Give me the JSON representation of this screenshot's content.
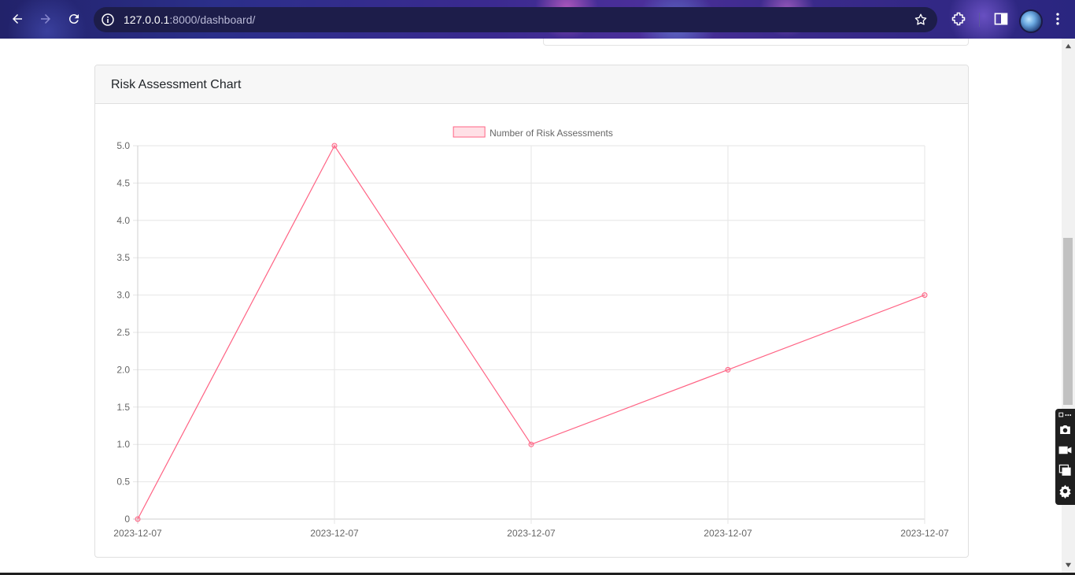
{
  "browser": {
    "url_host": "127.0.0.1",
    "url_path": ":8000/dashboard/",
    "icons": [
      "back-icon",
      "forward-icon",
      "reload-icon",
      "site-info-icon",
      "bookmark-star-icon",
      "extensions-icon",
      "side-panel-icon",
      "profile-avatar",
      "menu-kebab-icon"
    ]
  },
  "card": {
    "title": "Risk Assessment Chart"
  },
  "chart_data": {
    "type": "line",
    "x": [
      "2023-12-07",
      "2023-12-07",
      "2023-12-07",
      "2023-12-07",
      "2023-12-07"
    ],
    "series": [
      {
        "name": "Number of Risk Assessments",
        "values": [
          0,
          5,
          1,
          2,
          3
        ],
        "color": "#ff6384"
      }
    ],
    "ylim": [
      0,
      5
    ],
    "yticks": [
      "0",
      "0.5",
      "1.0",
      "1.5",
      "2.0",
      "2.5",
      "3.0",
      "3.5",
      "4.0",
      "4.5",
      "5.0"
    ],
    "grid": true,
    "legend_position": "top"
  },
  "capture_toolbar": {
    "icons": [
      "capture-menu-icon",
      "camera-icon",
      "video-icon",
      "window-icon",
      "settings-gear-icon"
    ]
  }
}
